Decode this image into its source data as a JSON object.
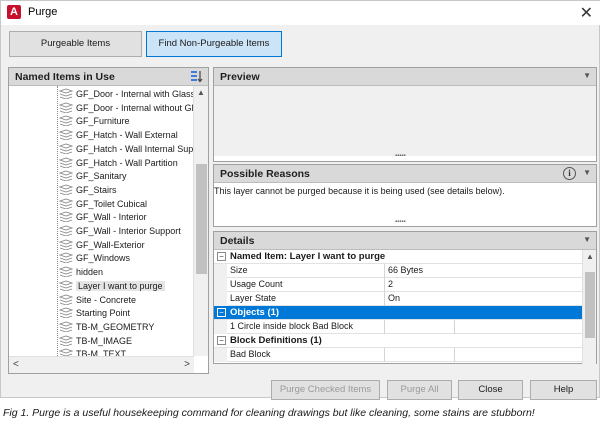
{
  "window": {
    "title": "Purge",
    "app_icon_letter": "A"
  },
  "tabs": [
    {
      "label": "Purgeable Items"
    },
    {
      "label": "Find Non-Purgeable Items"
    }
  ],
  "left_panel": {
    "title": "Named Items in Use",
    "items": [
      "GF_Door - Internal with Glass",
      "GF_Door - Internal without Gl",
      "GF_Furniture",
      "GF_Hatch - Wall External",
      "GF_Hatch - Wall Internal Sup",
      "GF_Hatch - Wall Partition",
      "GF_Sanitary",
      "GF_Stairs",
      "GF_Toilet Cubical",
      "GF_Wall - Interior",
      "GF_Wall - Interior Support",
      "GF_Wall-Exterior",
      "GF_Windows",
      "hidden",
      "Layer I want to purge",
      "Site - Concrete",
      "Starting Point",
      "TB-M_GEOMETRY",
      "TB-M_IMAGE",
      "TB-M_TEXT"
    ],
    "selected_index": 14
  },
  "preview": {
    "title": "Preview"
  },
  "reasons": {
    "title": "Possible Reasons",
    "text": "This layer cannot be purged because it is being used (see details below)."
  },
  "details": {
    "title": "Details",
    "named_item": {
      "title": "Named Item: Layer I want to purge"
    },
    "props": [
      {
        "key": "Size",
        "value": "66 Bytes"
      },
      {
        "key": "Usage Count",
        "value": "2"
      },
      {
        "key": "Layer State",
        "value": "On"
      }
    ],
    "objects": {
      "title": "Objects (1)",
      "row": "1 Circle inside block Bad Block"
    },
    "blocks": {
      "title": "Block Definitions (1)",
      "row": "Bad Block"
    }
  },
  "buttons": {
    "purge_checked": "Purge Checked Items",
    "purge_all": "Purge All",
    "close": "Close",
    "help": "Help"
  },
  "caption": "Fig 1. Purge is a useful housekeeping command for cleaning drawings but like cleaning, some stains are stubborn!",
  "colors": {
    "accent": "#0078d7",
    "tab_selected": "#cce4f7",
    "title_icon": "#c8102e"
  }
}
